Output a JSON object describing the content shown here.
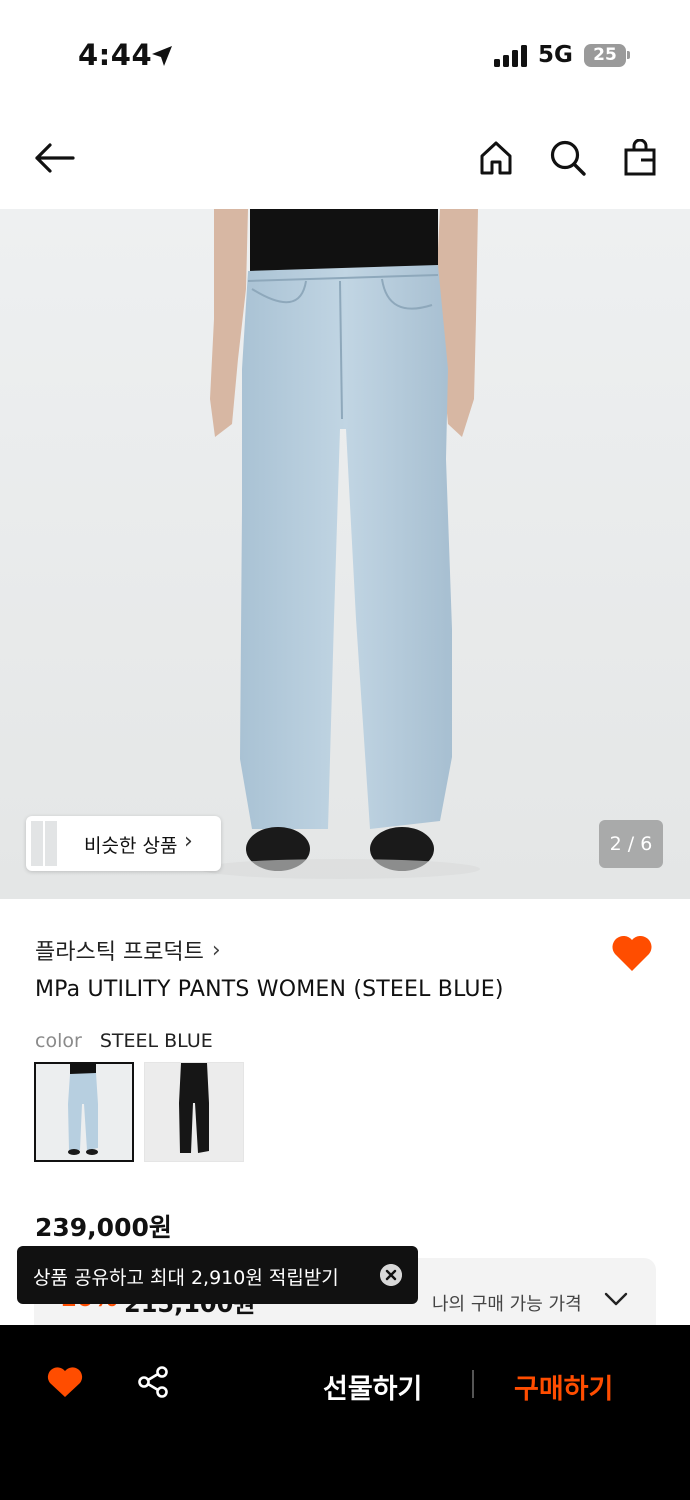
{
  "status_bar": {
    "time": "4:44",
    "network": "5G",
    "battery": "25"
  },
  "nav": {
    "back_icon": "arrow-left-icon",
    "home_icon": "home-icon",
    "search_icon": "search-icon",
    "bag_icon": "shopping-bag-icon"
  },
  "gallery": {
    "similar_label": "비슷한 상품",
    "similar_chevron": "›",
    "page_indicator": "2 / 6"
  },
  "product": {
    "brand": "플라스틱 프로덕트",
    "brand_chevron": "›",
    "title": "MPa UTILITY PANTS WOMEN (STEEL BLUE)",
    "color_label": "color",
    "color_value": "STEEL BLUE",
    "swatches": [
      "STEEL BLUE",
      "BLACK"
    ],
    "selected_swatch": 0,
    "price": "239,000원",
    "favorite": true
  },
  "price_box": {
    "hidden_discount": "10%",
    "hidden_price": "215,100원",
    "my_price_label": "나의 구매 가능 가격"
  },
  "toast": {
    "text": "상품 공유하고 최대 2,910원 적립받기"
  },
  "bottom_bar": {
    "gift_label": "선물하기",
    "buy_label": "구매하기"
  },
  "colors": {
    "accent": "#ff4d00",
    "bottom_bar_bg": "#000000",
    "denim": "#b7cfe0",
    "toast_bg": "#111111"
  }
}
